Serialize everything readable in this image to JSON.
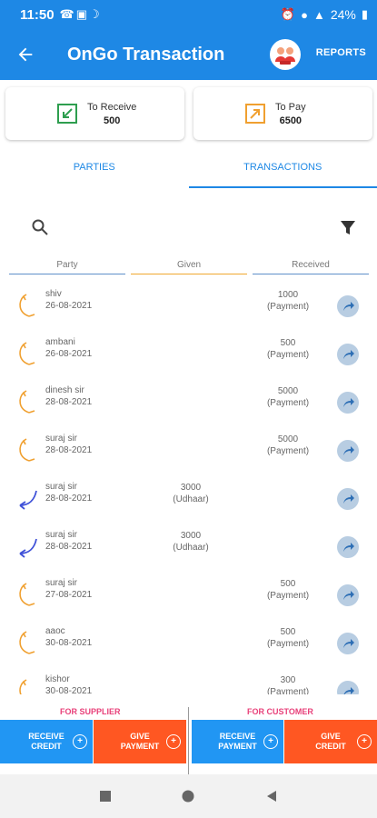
{
  "status_bar": {
    "time": "11:50",
    "battery": "24%"
  },
  "app_bar": {
    "title": "OnGo Transaction",
    "reports_label": "REPORTS"
  },
  "summary": {
    "receive": {
      "label": "To Receive",
      "value": "500",
      "icon": "receive-arrow-icon",
      "color": "#2e9e4f"
    },
    "pay": {
      "label": "To Pay",
      "value": "6500",
      "icon": "pay-arrow-icon",
      "color": "#f0a030"
    }
  },
  "tabs": [
    {
      "label": "PARTIES",
      "active": false
    },
    {
      "label": "TRANSACTIONS",
      "active": true
    }
  ],
  "columns": {
    "party": "Party",
    "given": "Given",
    "received": "Received"
  },
  "transactions": [
    {
      "name": "shiv",
      "date": "26-08-2021",
      "given": "",
      "given_type": "",
      "received": "1000",
      "received_type": "(Payment)",
      "direction": "out"
    },
    {
      "name": "ambani",
      "date": "26-08-2021",
      "given": "",
      "given_type": "",
      "received": "500",
      "received_type": "(Payment)",
      "direction": "out"
    },
    {
      "name": "dinesh sir",
      "date": "28-08-2021",
      "given": "",
      "given_type": "",
      "received": "5000",
      "received_type": "(Payment)",
      "direction": "out"
    },
    {
      "name": "suraj sir",
      "date": "28-08-2021",
      "given": "",
      "given_type": "",
      "received": "5000",
      "received_type": "(Payment)",
      "direction": "out"
    },
    {
      "name": "suraj sir",
      "date": "28-08-2021",
      "given": "3000",
      "given_type": "(Udhaar)",
      "received": "",
      "received_type": "",
      "direction": "in"
    },
    {
      "name": "suraj sir",
      "date": "28-08-2021",
      "given": "3000",
      "given_type": "(Udhaar)",
      "received": "",
      "received_type": "",
      "direction": "in"
    },
    {
      "name": "suraj sir",
      "date": "27-08-2021",
      "given": "",
      "given_type": "",
      "received": "500",
      "received_type": "(Payment)",
      "direction": "out"
    },
    {
      "name": "aaoc",
      "date": "30-08-2021",
      "given": "",
      "given_type": "",
      "received": "500",
      "received_type": "(Payment)",
      "direction": "out"
    },
    {
      "name": "kishor",
      "date": "30-08-2021",
      "given": "",
      "given_type": "",
      "received": "300",
      "received_type": "(Payment)",
      "direction": "out"
    }
  ],
  "sections": {
    "supplier": "FOR SUPPLIER",
    "customer": "FOR CUSTOMER"
  },
  "actions": {
    "supplier_receive": "RECEIVE\nCREDIT",
    "supplier_give": "GIVE\nPAYMENT",
    "customer_receive": "RECEIVE\nPAYMENT",
    "customer_give": "GIVE\nCREDIT"
  },
  "colors": {
    "primary": "#1e88e5",
    "orange_action": "#ff5722",
    "accent_pink": "#e8417a",
    "out_arrow": "#f0a030",
    "in_arrow": "#3f51d8"
  }
}
